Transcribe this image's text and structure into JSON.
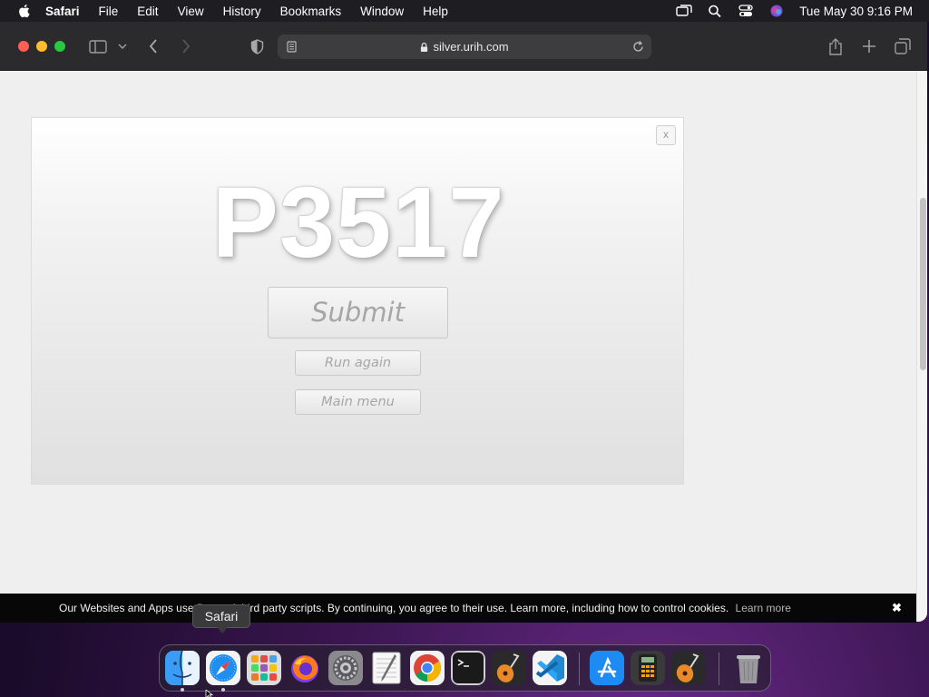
{
  "menubar": {
    "app_name": "Safari",
    "items": [
      "File",
      "Edit",
      "View",
      "History",
      "Bookmarks",
      "Window",
      "Help"
    ],
    "clock": "Tue May 30  9:16 PM"
  },
  "browser": {
    "url": "silver.urih.com"
  },
  "dialog": {
    "close_label": "x",
    "code": "P3517",
    "submit_label": "Submit",
    "run_again_label": "Run again",
    "main_menu_label": "Main menu"
  },
  "cookie_bar": {
    "text": "Our Websites and Apps use first and third party scripts. By continuing, you agree to their use. Learn more, including how to control cookies.",
    "link": "Learn more",
    "close": "✖"
  },
  "dock": {
    "tooltip": "Safari",
    "apps": [
      "finder",
      "safari",
      "launchpad",
      "firefox",
      "system-settings",
      "textedit",
      "chrome",
      "terminal",
      "garageband",
      "vscode",
      "app-store",
      "calculator",
      "garageband-2",
      "trash"
    ]
  },
  "colors": {
    "menubar_bg": "#1e1e22",
    "toolbar_bg": "#2b2b2d",
    "page_bg": "#efefef",
    "cookie_bg": "#070707"
  }
}
